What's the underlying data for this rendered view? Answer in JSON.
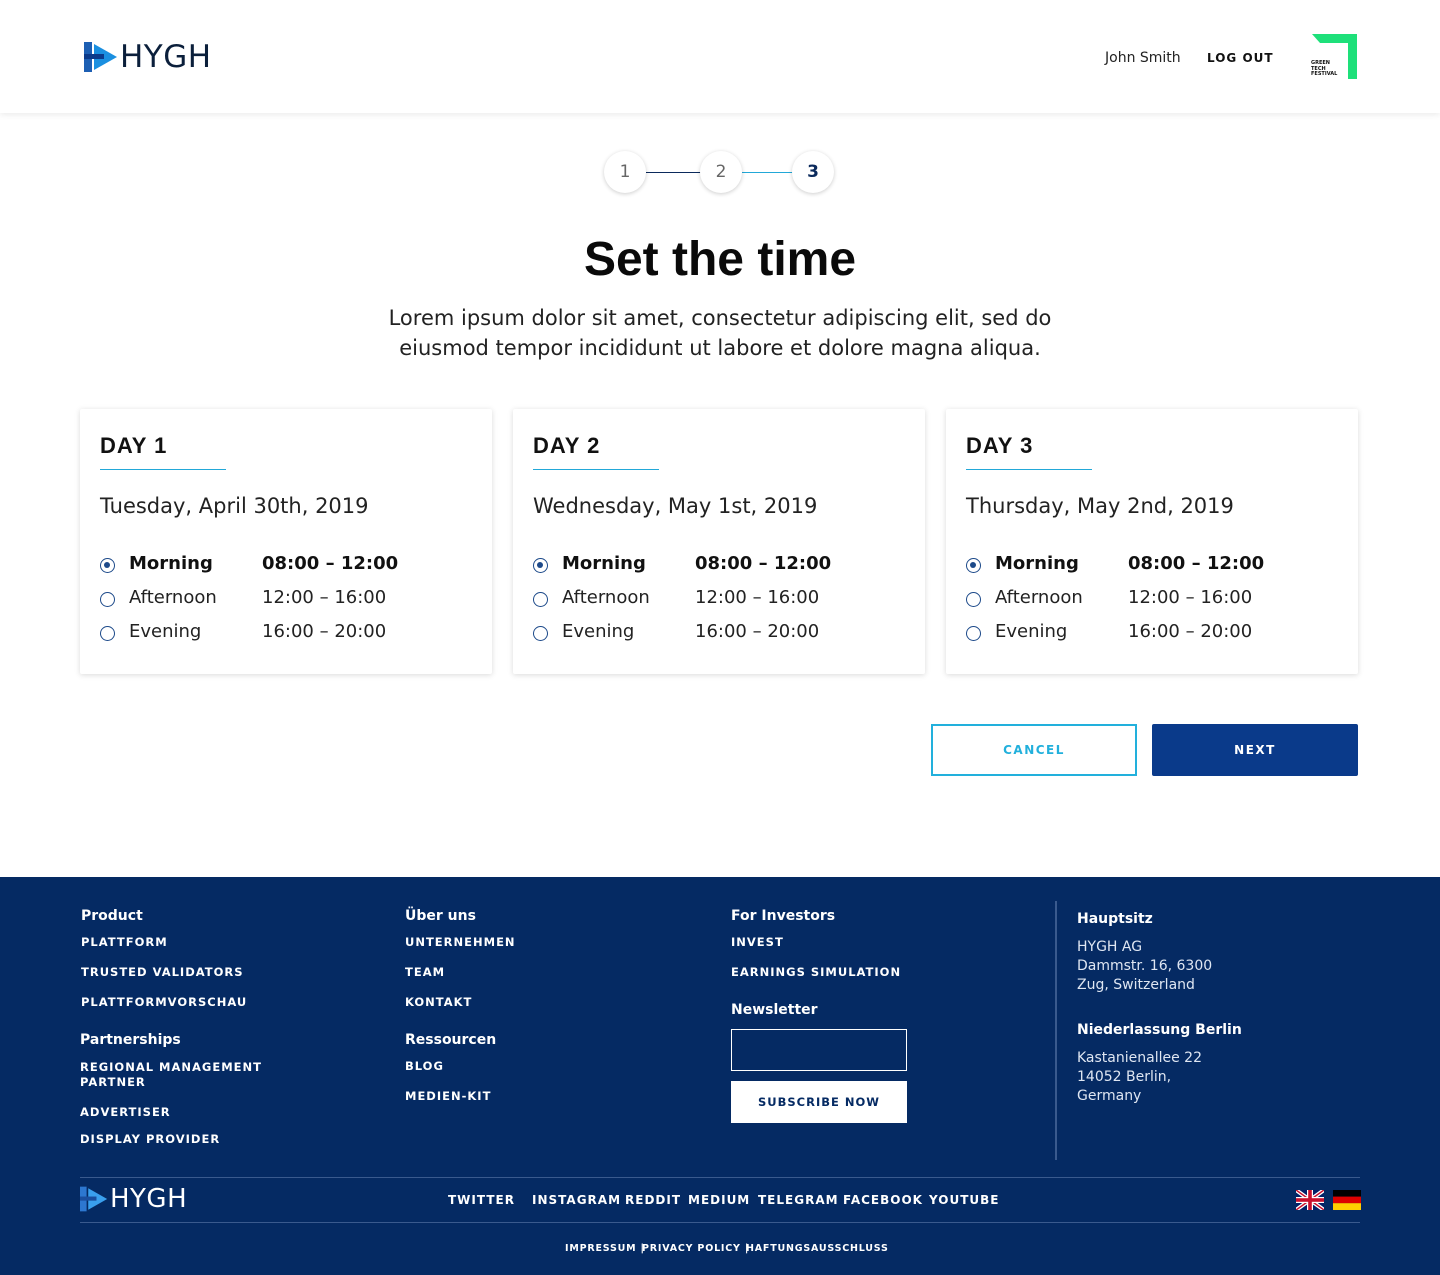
{
  "header": {
    "logo_text": "HYGH",
    "user_name": "John Smith",
    "logout_label": "LOG OUT",
    "partner_logo_text": [
      "GREEN",
      "TECH",
      "FESTIVAL"
    ]
  },
  "stepper": {
    "steps": [
      "1",
      "2",
      "3"
    ],
    "current": 3
  },
  "page": {
    "title": "Set the time",
    "subtitle": "Lorem ipsum dolor sit amet, consectetur adipiscing elit, sed do eiusmod tempor incididunt ut labore et dolore magna aliqua."
  },
  "days": [
    {
      "label": "DAY 1",
      "date": "Tuesday, April 30th, 2019",
      "slots": [
        {
          "name": "Morning",
          "time": "08:00 – 12:00",
          "selected": true
        },
        {
          "name": "Afternoon",
          "time": "12:00 – 16:00",
          "selected": false
        },
        {
          "name": "Evening",
          "time": "16:00 – 20:00",
          "selected": false
        }
      ]
    },
    {
      "label": "DAY 2",
      "date": "Wednesday, May 1st, 2019",
      "slots": [
        {
          "name": "Morning",
          "time": "08:00 – 12:00",
          "selected": true
        },
        {
          "name": "Afternoon",
          "time": "12:00 – 16:00",
          "selected": false
        },
        {
          "name": "Evening",
          "time": "16:00 – 20:00",
          "selected": false
        }
      ]
    },
    {
      "label": "DAY 3",
      "date": "Thursday, May 2nd, 2019",
      "slots": [
        {
          "name": "Morning",
          "time": "08:00 – 12:00",
          "selected": true
        },
        {
          "name": "Afternoon",
          "time": "12:00 – 16:00",
          "selected": false
        },
        {
          "name": "Evening",
          "time": "16:00 – 20:00",
          "selected": false
        }
      ]
    }
  ],
  "actions": {
    "cancel_label": "CANCEL",
    "next_label": "NEXT"
  },
  "footer": {
    "product": {
      "heading": "Product",
      "links": [
        "PLATTFORM",
        "TRUSTED VALIDATORS",
        "PLATTFORMVORSCHAU"
      ]
    },
    "partnerships": {
      "heading": "Partnerships",
      "links": [
        "REGIONAL MANAGEMENT PARTNER",
        "ADVERTISER",
        "DISPLAY PROVIDER"
      ]
    },
    "about": {
      "heading": "Über uns",
      "links": [
        "UNTERNEHMEN",
        "TEAM",
        "KONTAKT"
      ]
    },
    "resources": {
      "heading": "Ressourcen",
      "links": [
        "BLOG",
        "MEDIEN-KIT"
      ]
    },
    "investors": {
      "heading": "For Investors",
      "links": [
        "INVEST",
        "EARNINGS SIMULATION"
      ]
    },
    "newsletter": {
      "heading": "Newsletter",
      "input_value": "",
      "subscribe_label": "SUBSCRIBE NOW"
    },
    "hq": {
      "heading": "Hauptsitz",
      "lines": [
        "HYGH AG",
        "Dammstr. 16, 6300",
        "Zug, Switzerland"
      ]
    },
    "berlin": {
      "heading": "Niederlassung Berlin",
      "lines": [
        "Kastanienallee 22",
        "14052 Berlin,",
        "Germany"
      ]
    },
    "logo_text": "HYGH",
    "social": [
      "TWITTER",
      "INSTAGRAM",
      "REDDIT",
      "MEDIUM",
      "TELEGRAM",
      "FACEBOOK",
      "YOUTUBE"
    ],
    "flags": [
      "uk-flag-icon",
      "germany-flag-icon"
    ],
    "legal": [
      "IMPRESSUM |",
      "PRIVACY POLICY |",
      "HAFTUNGSAUSSCHLUSS"
    ]
  },
  "colors": {
    "brand_navy": "#052a63",
    "primary_button": "#0a3a8a",
    "accent_cyan": "#22b0dc",
    "partner_green": "#1ee07a"
  }
}
